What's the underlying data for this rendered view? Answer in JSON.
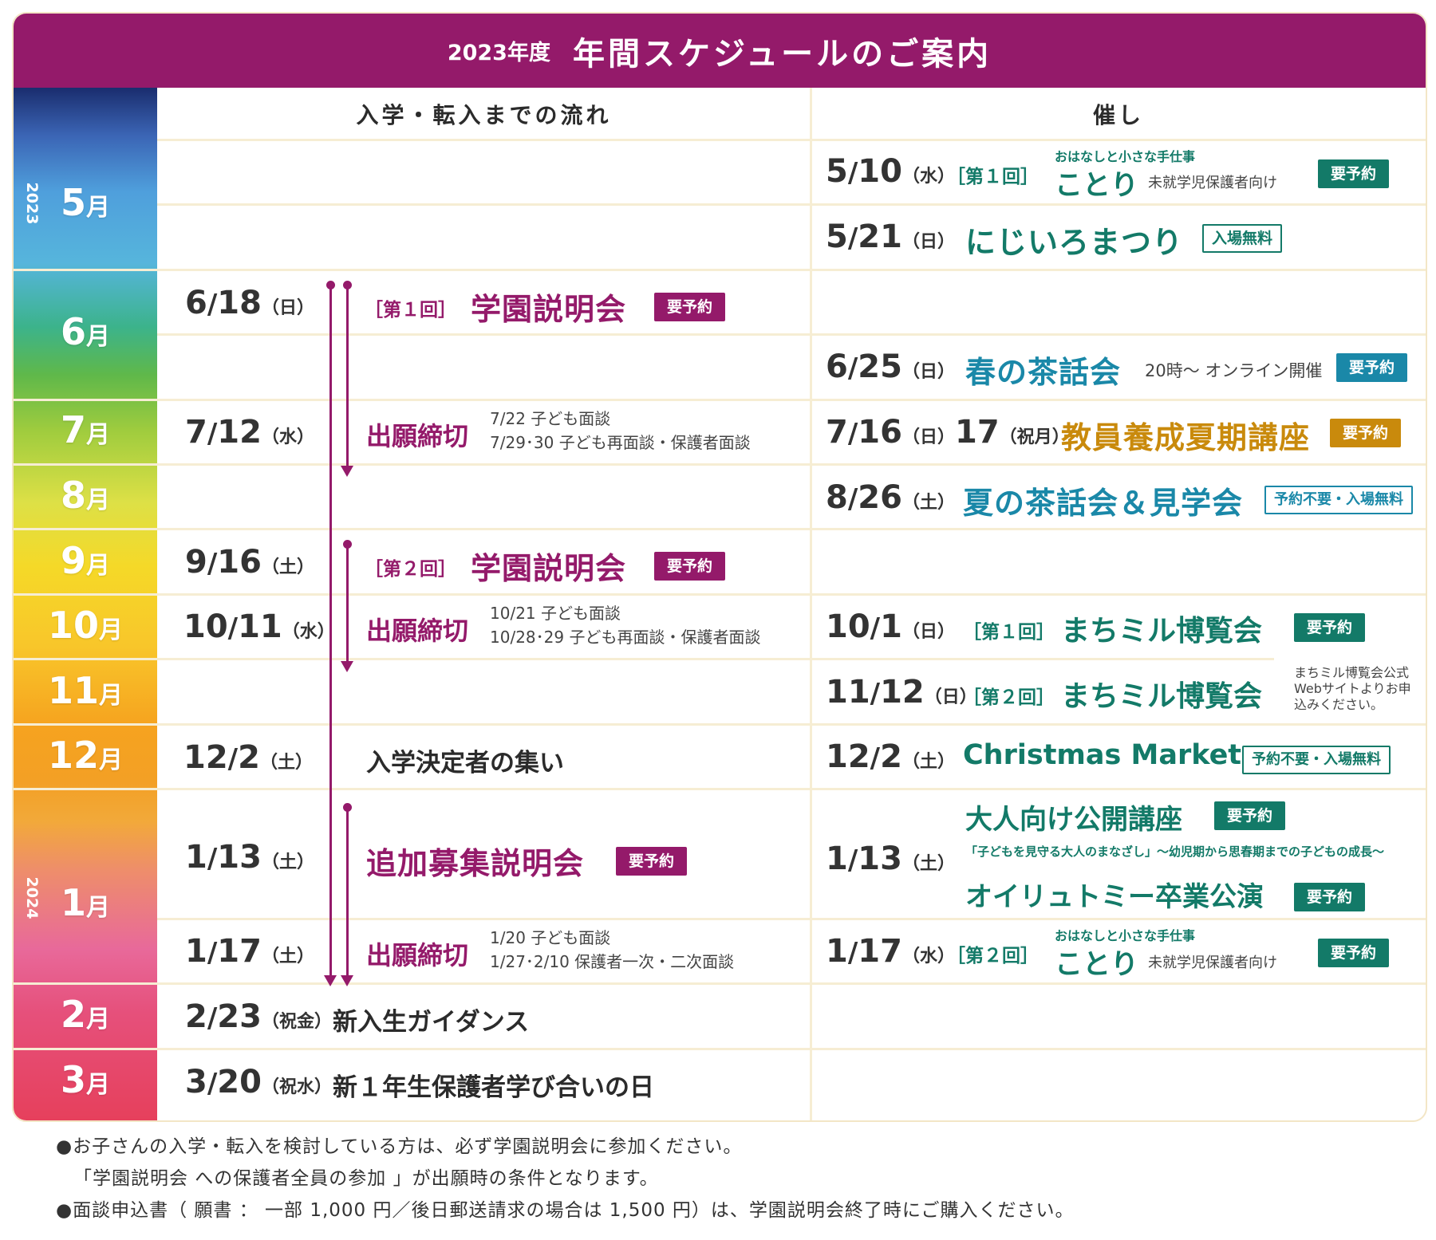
{
  "header": {
    "year": "2023年度",
    "title": "年間スケジュールのご案内"
  },
  "columns": {
    "flow": "入学・転入までの流れ",
    "events": "催し"
  },
  "years": {
    "y1": "2023",
    "y2": "2024"
  },
  "months": [
    "5",
    "6",
    "7",
    "8",
    "9",
    "10",
    "11",
    "12",
    "1",
    "2",
    "3"
  ],
  "month_unit": "月",
  "flow": {
    "r1": {
      "m": "6",
      "d": "18",
      "w": "日",
      "round": "［第１回］",
      "title": "学園説明会",
      "tag": "要予約"
    },
    "r2": {
      "m": "7",
      "d": "12",
      "w": "水",
      "title": "出願締切",
      "note1": "7/22 子ども面談",
      "note2": "7/29･30 子ども再面談・保護者面談"
    },
    "r3": {
      "m": "9",
      "d": "16",
      "w": "土",
      "round": "［第２回］",
      "title": "学園説明会",
      "tag": "要予約"
    },
    "r4": {
      "m": "10",
      "d": "11",
      "w": "水",
      "title": "出願締切",
      "note1": "10/21 子ども面談",
      "note2": "10/28･29 子ども再面談・保護者面談"
    },
    "r5": {
      "m": "12",
      "d": "2",
      "w": "土",
      "title": "入学決定者の集い"
    },
    "r6": {
      "m": "1",
      "d": "13",
      "w": "土",
      "title": "追加募集説明会",
      "tag": "要予約"
    },
    "r7": {
      "m": "1",
      "d": "17",
      "w": "土",
      "title": "出願締切",
      "note1": "1/20 子ども面談",
      "note2": "1/27･2/10 保護者一次・二次面談"
    },
    "r8": {
      "m": "2",
      "d": "23",
      "w": "祝金",
      "title": "新入生ガイダンス"
    },
    "r9": {
      "m": "3",
      "d": "20",
      "w": "祝水",
      "title": "新１年生保護者学び合いの日"
    }
  },
  "events": {
    "e1": {
      "m": "5",
      "d": "10",
      "w": "水",
      "round": "［第１回］",
      "sub": "おはなしと小さな手仕事",
      "title": "ことり",
      "aud": "未就学児保護者向け",
      "tag": "要予約"
    },
    "e2": {
      "m": "5",
      "d": "21",
      "w": "日",
      "title": "にじいろまつり",
      "tag": "入場無料"
    },
    "e3": {
      "m": "6",
      "d": "25",
      "w": "日",
      "title": "春の茶話会",
      "note": "20時〜 オンライン開催",
      "tag": "要予約"
    },
    "e4": {
      "m": "7",
      "d": "16",
      "w": "日",
      "d2": "17",
      "w2": "祝月",
      "title": "教員養成夏期講座",
      "tag": "要予約"
    },
    "e5": {
      "m": "8",
      "d": "26",
      "w": "土",
      "title": "夏の茶話会＆見学会",
      "tag": "予約不要・入場無料"
    },
    "e6": {
      "m": "10",
      "d": "1",
      "w": "日",
      "round": "［第１回］",
      "title": "まちミル博覧会",
      "tag": "要予約"
    },
    "e7": {
      "m": "11",
      "d": "12",
      "w": "日",
      "round": "［第２回］",
      "title": "まちミル博覧会"
    },
    "e67note": {
      "l1": "まちミル博覧会公式",
      "l2": "Webサイトよりお申",
      "l3": "込みください。"
    },
    "e8": {
      "m": "12",
      "d": "2",
      "w": "土",
      "title": "Christmas Market",
      "tag": "予約不要・入場無料"
    },
    "e9": {
      "m": "1",
      "d": "13",
      "w": "土",
      "title": "大人向け公開講座",
      "tag": "要予約",
      "sub": "「子どもを見守る大人のまなざし」〜幼児期から思春期までの子どもの成長〜",
      "title2": "オイリュトミー卒業公演",
      "tag2": "要予約"
    },
    "e10": {
      "m": "1",
      "d": "17",
      "w": "水",
      "round": "［第２回］",
      "sub": "おはなしと小さな手仕事",
      "title": "ことり",
      "aud": "未就学児保護者向け",
      "tag": "要予約"
    }
  },
  "notes": {
    "n1": "●お子さんの入学・転入を検討している方は、必ず学園説明会に参加ください。",
    "n2": "「学園説明会 への保護者全員の参加 」が出願時の条件となります。",
    "n3": "●面談申込書（ 願書 ： 一部 1,000 円／後日郵送請求の場合は 1,500 円）は、学園説明会終了時にご購入ください。"
  },
  "colors": {
    "magenta": "#941a6a",
    "green": "#137a68",
    "teal": "#1a88a8",
    "gold": "#c98a0c"
  }
}
